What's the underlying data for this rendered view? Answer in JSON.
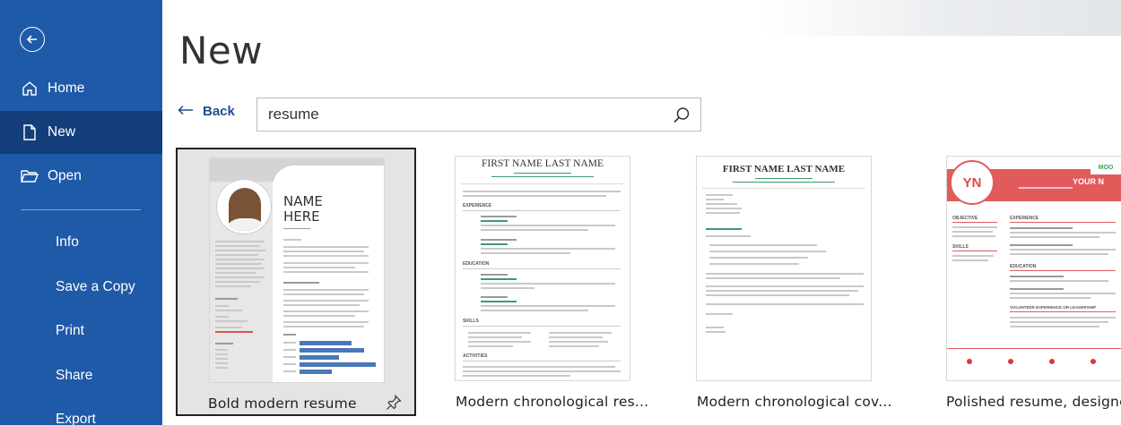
{
  "sidebar": {
    "items": [
      {
        "label": "Home",
        "icon": "home-icon"
      },
      {
        "label": "New",
        "icon": "new-document-icon"
      },
      {
        "label": "Open",
        "icon": "open-folder-icon"
      }
    ],
    "sub_items": [
      "Info",
      "Save a Copy",
      "Print",
      "Share",
      "Export"
    ],
    "accent": "#1f5aa8",
    "active_bg": "#133e7a"
  },
  "main": {
    "title": "New",
    "back_label": "Back",
    "search_value": "resume",
    "templates": [
      {
        "label": "Bold modern resume",
        "selected": true
      },
      {
        "label": "Modern chronological res..."
      },
      {
        "label": "Modern chronological cov..."
      },
      {
        "label": "Polished resume, designe..."
      }
    ]
  },
  "thumbs": {
    "bold": {
      "name_line1": "NAME",
      "name_line2": "HERE"
    },
    "chrono_resume": {
      "heading": "FIRST NAME LAST NAME",
      "section1": "EXPERIENCE",
      "section2": "EDUCATION",
      "section3": "SKILLS",
      "section4": "ACTIVITIES"
    },
    "chrono_cover": {
      "heading": "FIRST NAME LAST NAME"
    },
    "polished": {
      "initials": "YN",
      "header": "YOUR N",
      "badge": "MOO",
      "col1a": "OBJECTIVE",
      "col1b": "SKILLS",
      "col2a": "EXPERIENCE",
      "col2b": "EDUCATION",
      "col2c": "VOLUNTEER EXPERIENCE OR LEADERSHIP"
    }
  }
}
